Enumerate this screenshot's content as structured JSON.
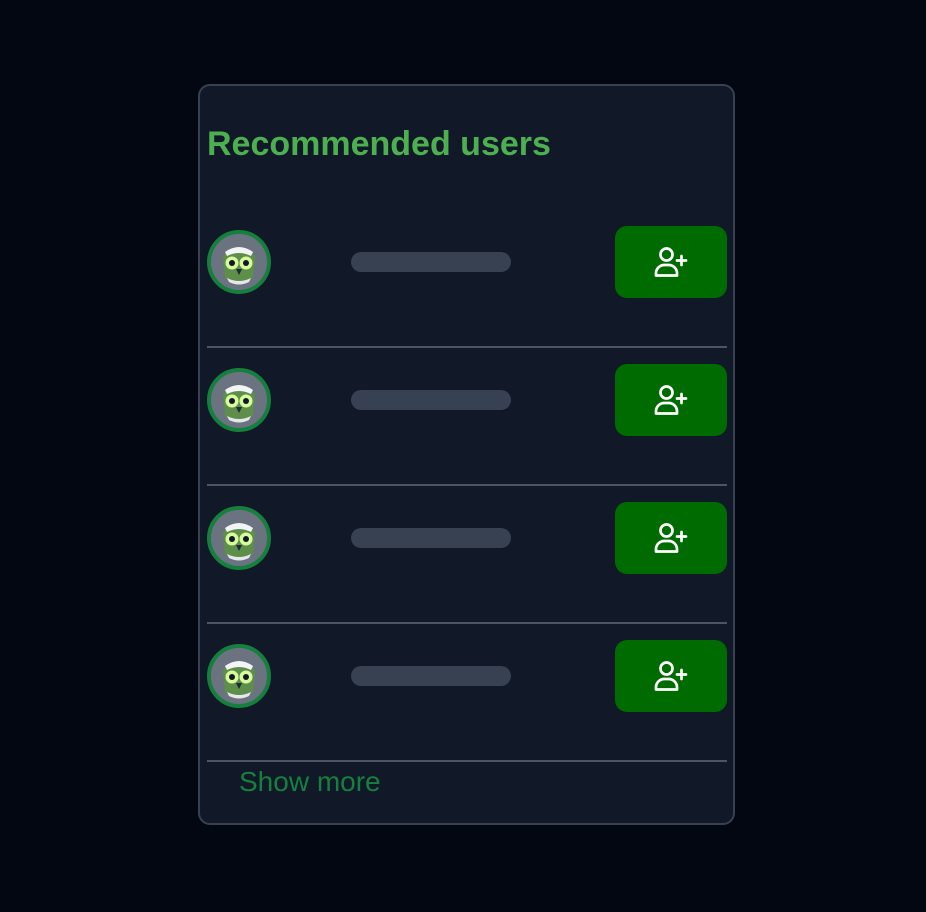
{
  "panel": {
    "title": "Recommended users",
    "show_more_label": "Show more",
    "accent_color": "#4CAF50",
    "button_color": "#006B00"
  },
  "users": [
    {
      "avatar_icon": "owl-avatar-icon",
      "name_loading": true,
      "action_icon": "user-plus-icon"
    },
    {
      "avatar_icon": "owl-avatar-icon",
      "name_loading": true,
      "action_icon": "user-plus-icon"
    },
    {
      "avatar_icon": "owl-avatar-icon",
      "name_loading": true,
      "action_icon": "user-plus-icon"
    },
    {
      "avatar_icon": "owl-avatar-icon",
      "name_loading": true,
      "action_icon": "user-plus-icon"
    }
  ]
}
